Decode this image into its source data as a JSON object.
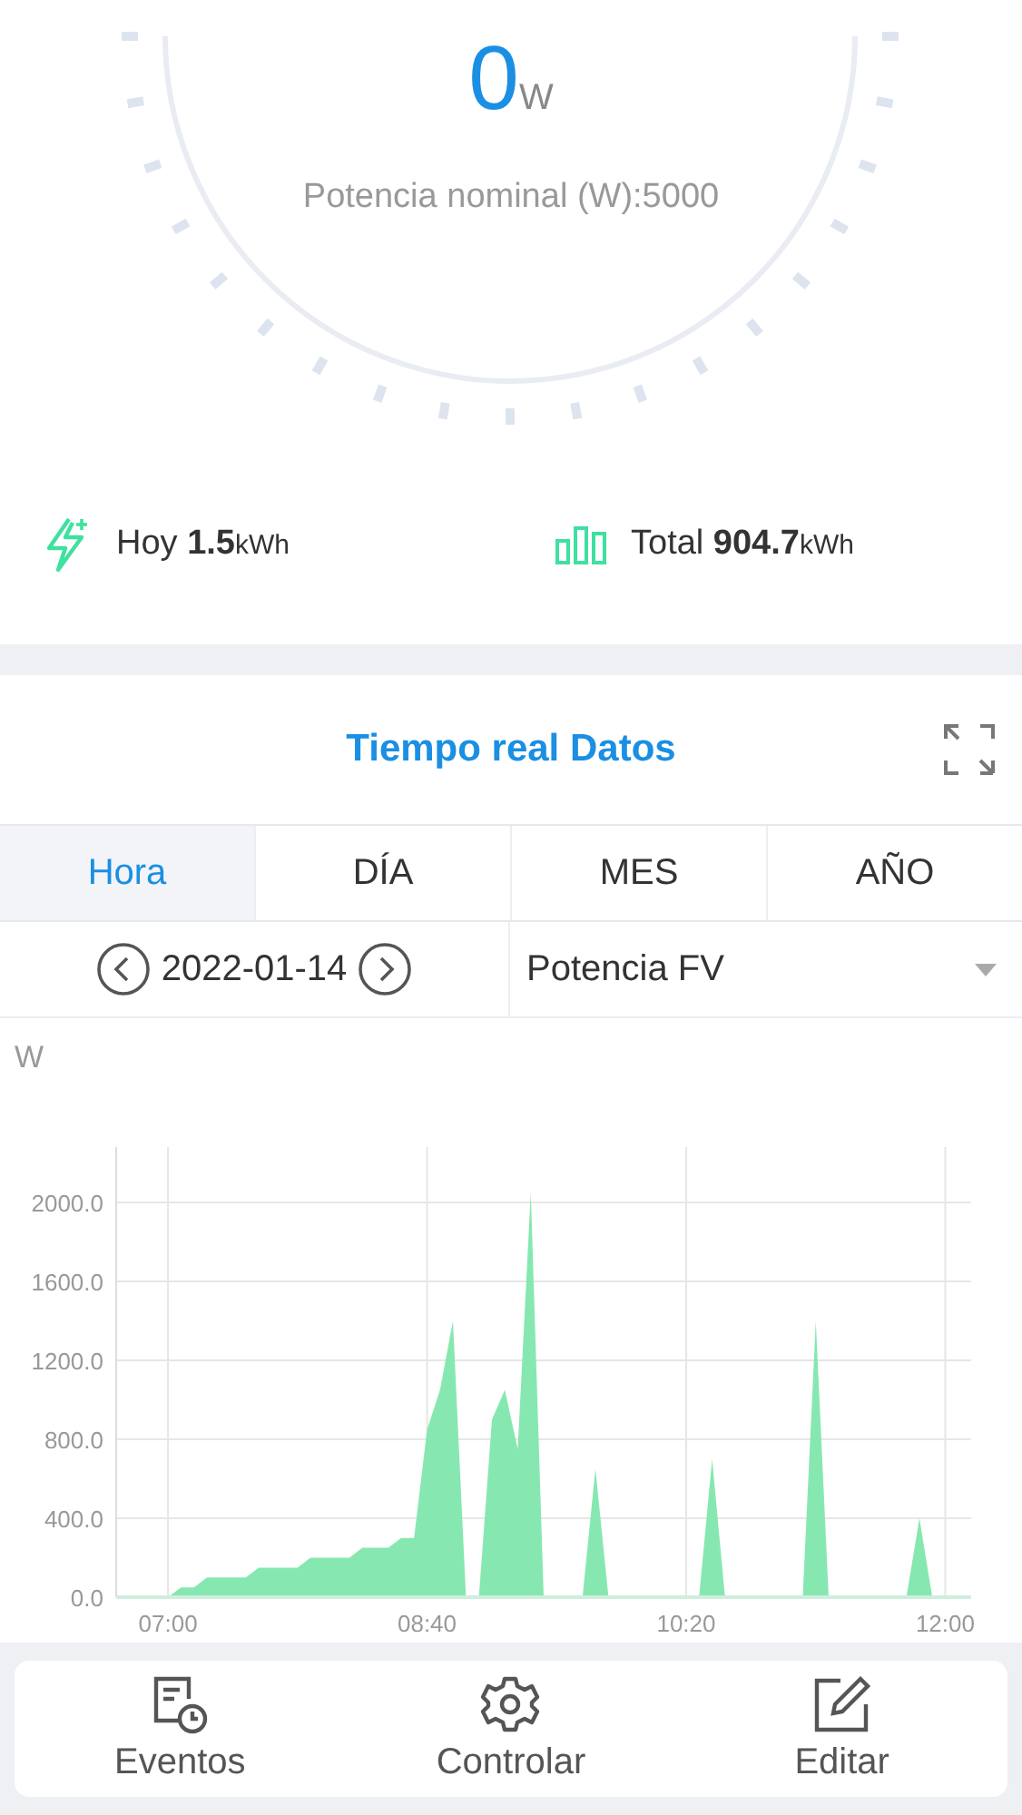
{
  "gauge": {
    "value": "0",
    "unit": "W",
    "rated": "Potencia nominal (W):5000"
  },
  "stats": [
    {
      "kind": "today",
      "label": "Hoy",
      "value": "1.5",
      "unit": "kWh"
    },
    {
      "kind": "total",
      "label": "Total",
      "value": "904.7",
      "unit": "kWh"
    }
  ],
  "panel": {
    "title": "Tiempo real Datos",
    "tabs": [
      {
        "label": "Hora",
        "selected": true
      },
      {
        "label": "DÍA",
        "selected": false
      },
      {
        "label": "MES",
        "selected": false
      },
      {
        "label": "AÑO",
        "selected": false
      }
    ],
    "date": "2022-01-14",
    "metric": "Potencia FV",
    "chart_data": {
      "type": "area",
      "ylabel": "W",
      "x": [
        400,
        405,
        410,
        415,
        420,
        425,
        430,
        435,
        440,
        445,
        450,
        455,
        460,
        465,
        470,
        475,
        480,
        485,
        490,
        495,
        500,
        505,
        510,
        515,
        520,
        525,
        530,
        535,
        540,
        545,
        550,
        555,
        560,
        565,
        570,
        575,
        580,
        585,
        590,
        595,
        600,
        605,
        610,
        615,
        620,
        625,
        630,
        635,
        640,
        645,
        650,
        655,
        660,
        665,
        670,
        675,
        680,
        685,
        690,
        695,
        700,
        705,
        710,
        715,
        720,
        725,
        730
      ],
      "series": [
        {
          "color": "#86e8b0",
          "values": [
            0,
            0,
            0,
            0,
            0,
            50,
            50,
            100,
            100,
            100,
            100,
            150,
            150,
            150,
            150,
            200,
            200,
            200,
            200,
            250,
            250,
            250,
            300,
            300,
            850,
            1050,
            1400,
            0,
            0,
            900,
            1050,
            750,
            2050,
            0,
            0,
            0,
            0,
            650,
            0,
            0,
            0,
            0,
            0,
            0,
            0,
            0,
            700,
            0,
            0,
            0,
            0,
            0,
            0,
            0,
            1400,
            0,
            0,
            0,
            0,
            0,
            0,
            0,
            400,
            0,
            0,
            0,
            0
          ]
        }
      ],
      "grid": true,
      "xlim": [
        400,
        730
      ],
      "ylim": [
        0,
        2280
      ],
      "xticks": [
        {
          "value": 420,
          "label": "07:00"
        },
        {
          "value": 520,
          "label": "08:40"
        },
        {
          "value": 620,
          "label": "10:20"
        },
        {
          "value": 720,
          "label": "12:00"
        }
      ],
      "yticks": [
        {
          "value": 0,
          "label": "0.0"
        },
        {
          "value": 400,
          "label": "400.0"
        },
        {
          "value": 800,
          "label": "800.0"
        },
        {
          "value": 1200,
          "label": "1200.0"
        },
        {
          "value": 1600,
          "label": "1600.0"
        },
        {
          "value": 2000,
          "label": "2000.0"
        }
      ]
    }
  },
  "nav": [
    {
      "kind": "events",
      "label": "Eventos"
    },
    {
      "kind": "control",
      "label": "Controlar"
    },
    {
      "kind": "edit",
      "label": "Editar"
    }
  ]
}
